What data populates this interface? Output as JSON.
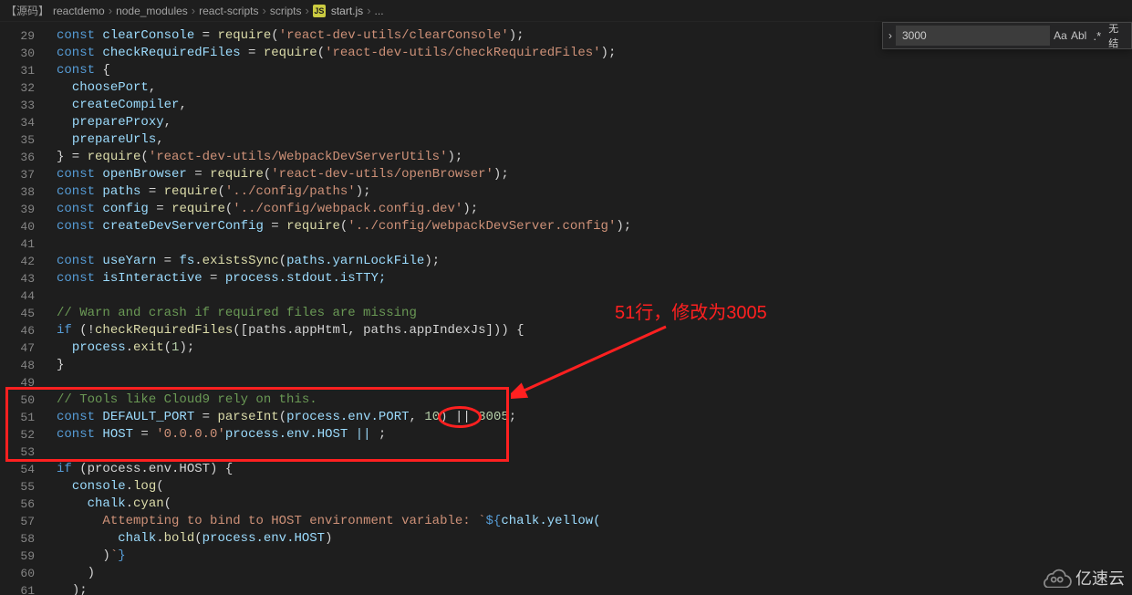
{
  "breadcrumb": {
    "tag": "【源码】",
    "parts": [
      "reactdemo",
      "node_modules",
      "react-scripts",
      "scripts"
    ],
    "file_icon": "JS",
    "file": "start.js",
    "tail": "..."
  },
  "find": {
    "value": "3000",
    "icon_case": "Aa",
    "icon_word": "Abl",
    "icon_regex": ".*",
    "result_text": "无结"
  },
  "line_start": 29,
  "line_end": 61,
  "annotation": {
    "text": "51行，修改为3005"
  },
  "watermark": {
    "label": "亿速云"
  },
  "code": {
    "l29": {
      "pre": "",
      "k": "const",
      "sp": " ",
      "v": "clearConsole",
      "eq": " = ",
      "f": "require",
      "op": "(",
      "s": "'react-dev-utils/clearConsole'",
      "cp": ");"
    },
    "l30": {
      "pre": "",
      "k": "const",
      "sp": " ",
      "v": "checkRequiredFiles",
      "eq": " = ",
      "f": "require",
      "op": "(",
      "s": "'react-dev-utils/checkRequiredFiles'",
      "cp": ");"
    },
    "l31": {
      "pre": "",
      "k": "const",
      "sp": " ",
      "ob": "{"
    },
    "l32": {
      "pre": "  ",
      "v": "choosePort",
      "p": ","
    },
    "l33": {
      "pre": "  ",
      "v": "createCompiler",
      "p": ","
    },
    "l34": {
      "pre": "  ",
      "v": "prepareProxy",
      "p": ","
    },
    "l35": {
      "pre": "  ",
      "v": "prepareUrls",
      "p": ","
    },
    "l36": {
      "pre": "",
      "cb": "} = ",
      "f": "require",
      "op": "(",
      "s": "'react-dev-utils/WebpackDevServerUtils'",
      "cp": ");"
    },
    "l37": {
      "pre": "",
      "k": "const",
      "sp": " ",
      "v": "openBrowser",
      "eq": " = ",
      "f": "require",
      "op": "(",
      "s": "'react-dev-utils/openBrowser'",
      "cp": ");"
    },
    "l38": {
      "pre": "",
      "k": "const",
      "sp": " ",
      "v": "paths",
      "eq": " = ",
      "f": "require",
      "op": "(",
      "s": "'../config/paths'",
      "cp": ");"
    },
    "l39": {
      "pre": "",
      "k": "const",
      "sp": " ",
      "v": "config",
      "eq": " = ",
      "f": "require",
      "op": "(",
      "s": "'../config/webpack.config.dev'",
      "cp": ");"
    },
    "l40": {
      "pre": "",
      "k": "const",
      "sp": " ",
      "v": "createDevServerConfig",
      "eq": " = ",
      "f": "require",
      "op": "(",
      "s": "'../config/webpackDevServer.config'",
      "cp": ");"
    },
    "l41": "",
    "l42": {
      "pre": "",
      "k": "const",
      "sp": " ",
      "v": "useYarn",
      "eq": " = ",
      "obj": "fs",
      "dot": ".",
      "f": "existsSync",
      "op": "(",
      "arg": "paths.yarnLockFile",
      "cp": ");"
    },
    "l43": {
      "pre": "",
      "k": "const",
      "sp": " ",
      "v": "isInteractive",
      "eq": " = ",
      "rhs": "process.stdout.isTTY;"
    },
    "l44": "",
    "l45": {
      "pre": "",
      "c": "// Warn and crash if required files are missing"
    },
    "l46": {
      "pre": "",
      "k": "if",
      "sp": " ",
      "cond": "(!",
      "f": "checkRequiredFiles",
      "args": "([paths.appHtml, paths.appIndexJs])) {"
    },
    "l47": {
      "pre": "  ",
      "obj": "process",
      "dot": ".",
      "f": "exit",
      "op": "(",
      "n": "1",
      "cp": ");"
    },
    "l48": {
      "pre": "",
      "cb": "}"
    },
    "l49": "",
    "l50": {
      "pre": "",
      "c": "// Tools like Cloud9 rely on this."
    },
    "l51": {
      "pre": "",
      "k": "const",
      "sp": " ",
      "v": "DEFAULT_PORT",
      "eq": " = ",
      "f": "parseInt",
      "op": "(",
      "arg": "process.env.PORT",
      "comma": ", ",
      "n": "10",
      "cp": ") || ",
      "n2": "3005",
      "semi": ";"
    },
    "l52": {
      "pre": "",
      "k": "const",
      "sp": " ",
      "v": "HOST",
      "eq": " = ",
      "rhs": "process.env.HOST || ",
      "s": "'0.0.0.0'",
      "semi": ";"
    },
    "l53": "",
    "l54": {
      "pre": "",
      "k": "if",
      "sp": " ",
      "cond": "(process.env.HOST) {"
    },
    "l55": {
      "pre": "  ",
      "obj": "console",
      "dot": ".",
      "f": "log",
      "op": "("
    },
    "l56": {
      "pre": "    ",
      "obj": "chalk",
      "dot": ".",
      "f": "cyan",
      "op": "("
    },
    "l57": {
      "pre": "      ",
      "bt": "`",
      "s": "Attempting to bind to HOST environment variable: ",
      "tpl": "${",
      "expr": "chalk.yellow("
    },
    "l58": {
      "pre": "        ",
      "obj": "chalk",
      "dot": ".",
      "f": "bold",
      "op": "(",
      "arg": "process.env.HOST",
      "cp": ")"
    },
    "l59": {
      "pre": "      ",
      "cp": ")",
      "tpl": "}",
      "bt": "`"
    },
    "l60": {
      "pre": "    ",
      "cp": ")"
    },
    "l61": {
      "pre": "  ",
      "cp": ");"
    }
  }
}
